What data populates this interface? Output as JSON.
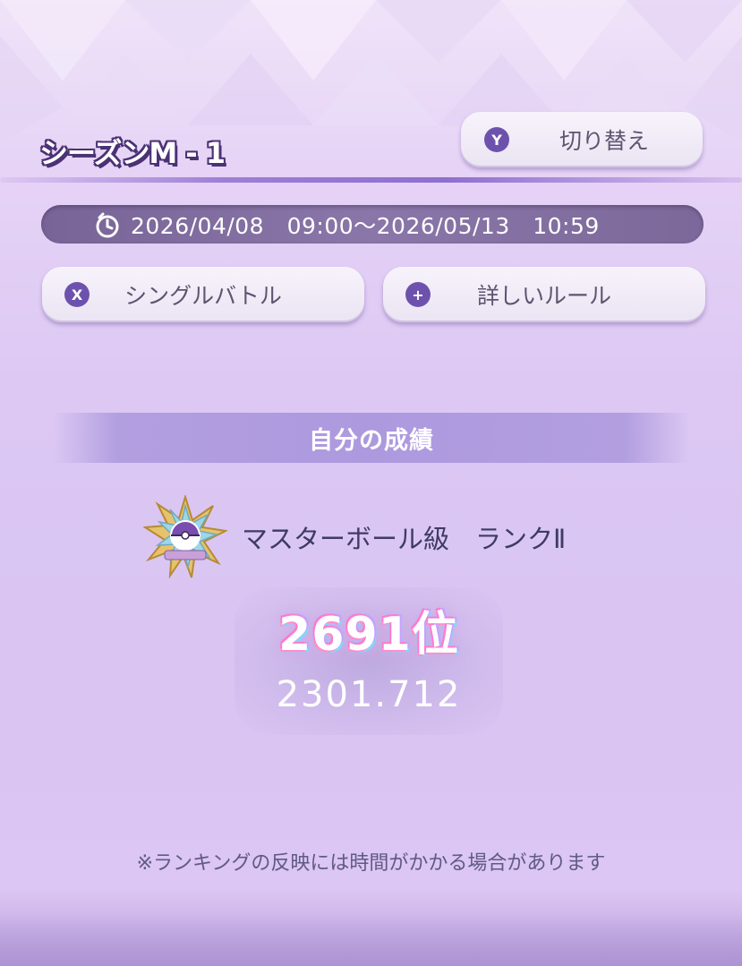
{
  "header": {
    "season_title": "シーズンM - 1",
    "switch_button": {
      "badge": "Y",
      "label": "切り替え"
    }
  },
  "period": {
    "icon": "timer-icon",
    "text": "2026/04/08　09:00〜2026/05/13　10:59"
  },
  "actions": {
    "battle_mode": {
      "badge": "X",
      "label": "シングルバトル"
    },
    "rules": {
      "badge": "+",
      "label": "詳しいルール"
    }
  },
  "results": {
    "section_title": "自分の成績",
    "rank_emblem": "master-ball-rank-emblem",
    "rank_label": "マスターボール級　ランクⅡ",
    "placement": "2691位",
    "rating": "2301.712"
  },
  "footnote": "※ランキングの反映には時間がかかる場合があります",
  "colors": {
    "accent": "#6d52ad",
    "title_outline": "#4a3275",
    "date_bar": "#7d6a9b",
    "section_header": "#ad99de",
    "rank_text": "#3e3a66",
    "footnote_text": "#5f5a84"
  }
}
